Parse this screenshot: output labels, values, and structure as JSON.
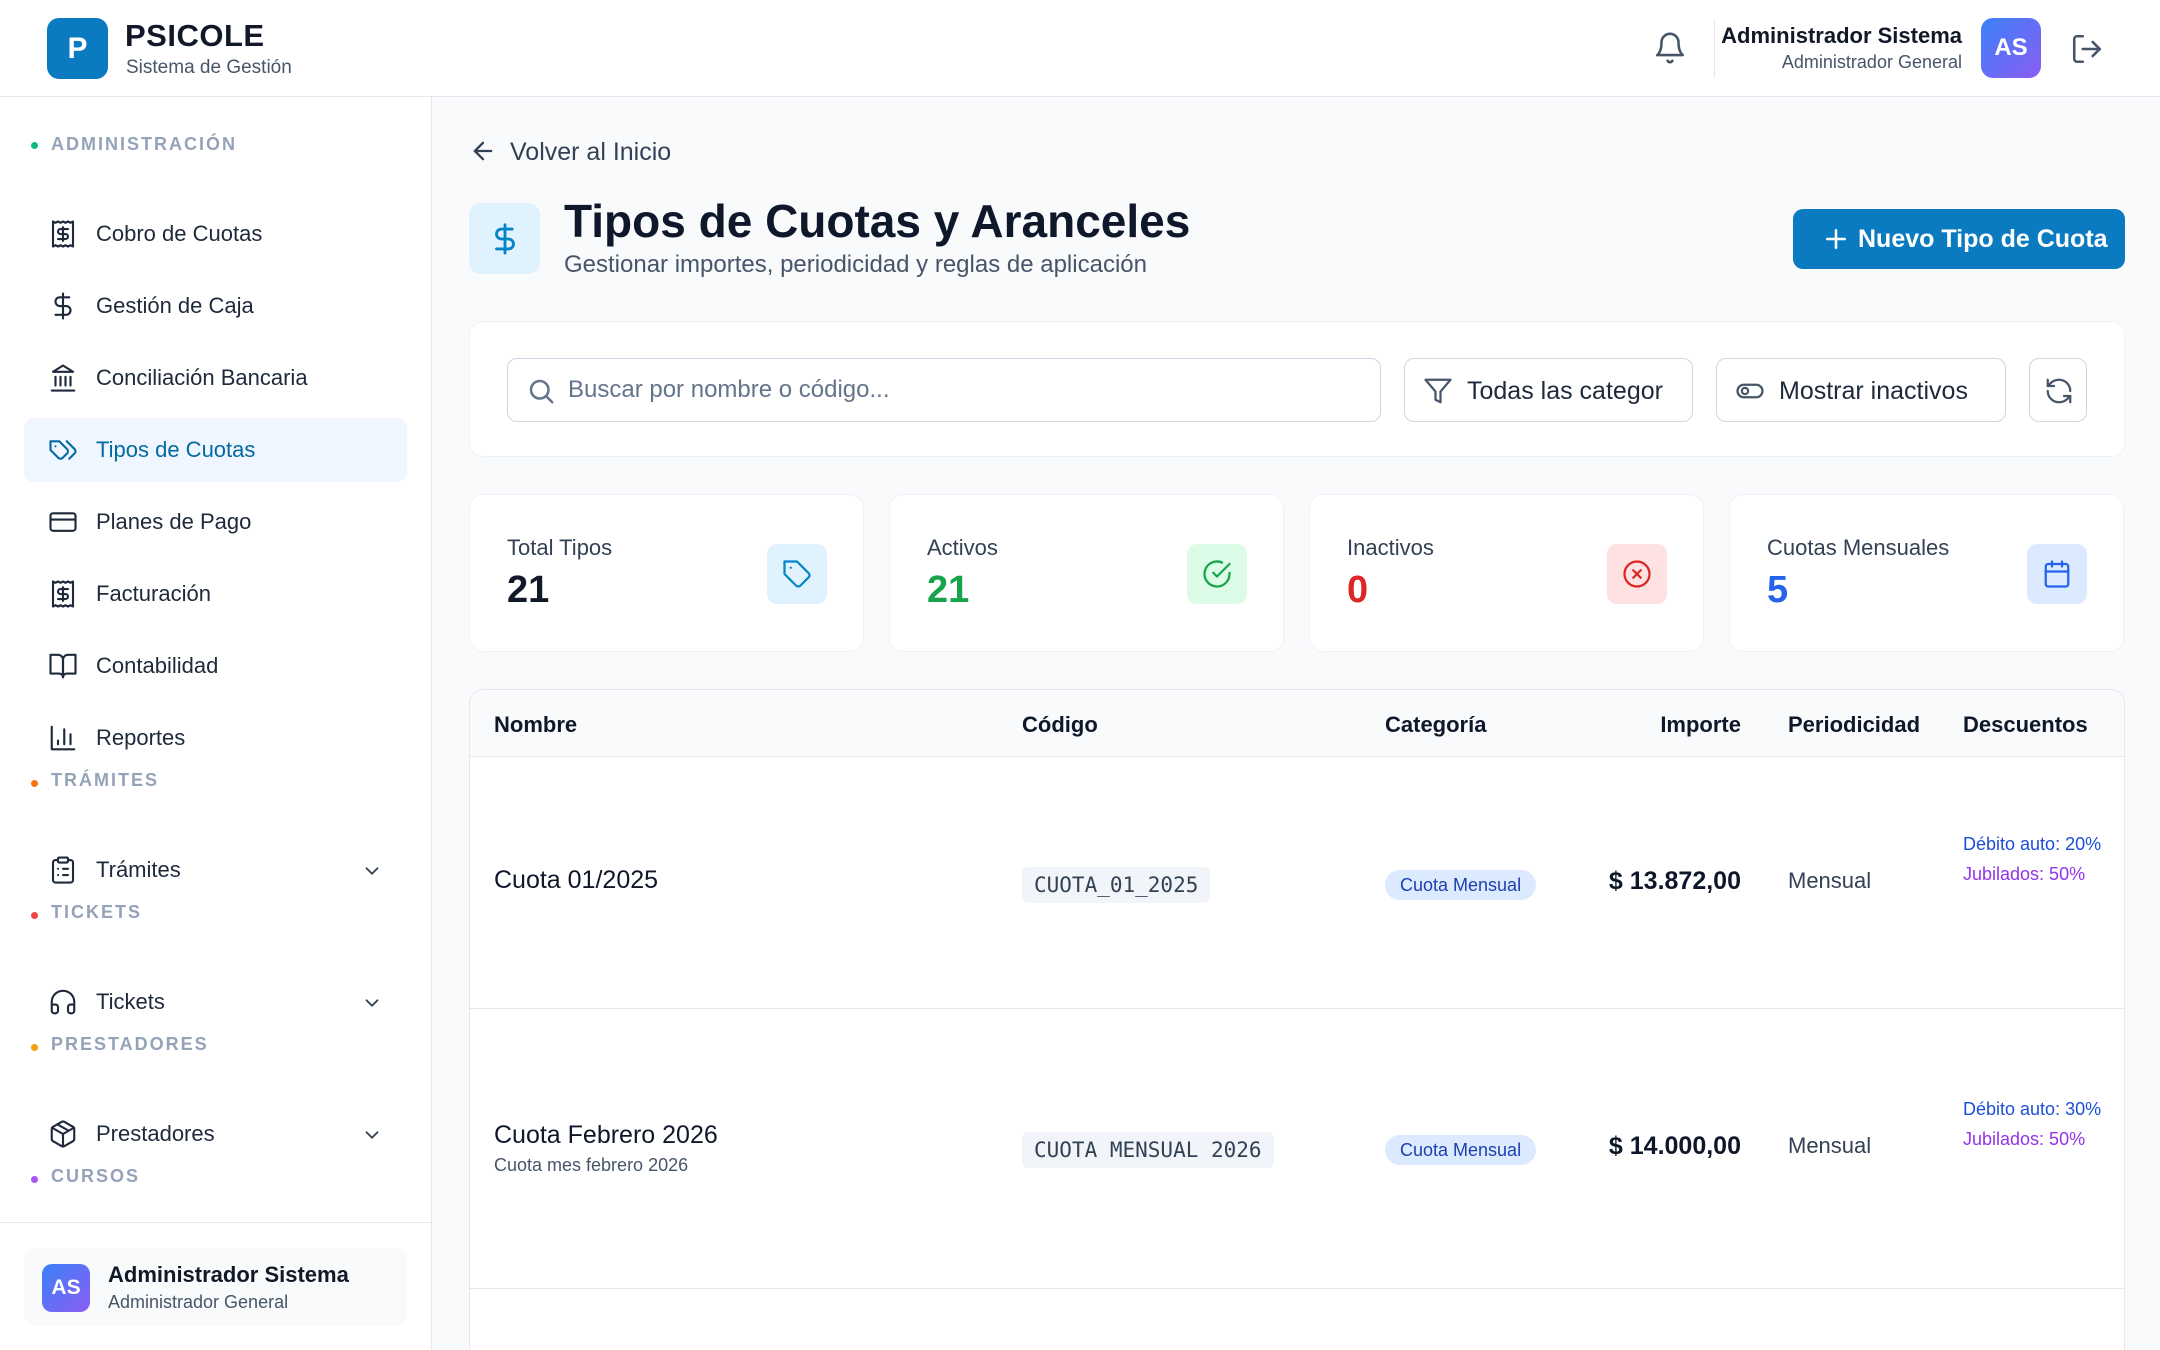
{
  "header": {
    "logo_letter": "P",
    "app_name": "PSICOLE",
    "app_subtitle": "Sistema de Gestión",
    "user_name": "Administrador Sistema",
    "user_role": "Administrador General",
    "user_initials": "AS"
  },
  "sidebar": {
    "sections": [
      {
        "title": "ADMINISTRACIÓN",
        "color": "#10b981"
      },
      {
        "title": "TRÁMITES",
        "color": "#f97316"
      },
      {
        "title": "TICKETS",
        "color": "#ef4444"
      },
      {
        "title": "PRESTADORES",
        "color": "#f59e0b"
      },
      {
        "title": "CURSOS",
        "color": "#a855f7"
      }
    ],
    "items": [
      {
        "label": "Cobro de Cuotas",
        "icon": "receipt-dollar-icon"
      },
      {
        "label": "Gestión de Caja",
        "icon": "dollar-icon"
      },
      {
        "label": "Conciliación Bancaria",
        "icon": "bank-icon"
      },
      {
        "label": "Tipos de Cuotas",
        "icon": "tags-icon",
        "active": true
      },
      {
        "label": "Planes de Pago",
        "icon": "credit-card-icon"
      },
      {
        "label": "Facturación",
        "icon": "receipt-dollar-icon"
      },
      {
        "label": "Contabilidad",
        "icon": "book-open-icon"
      },
      {
        "label": "Reportes",
        "icon": "bar-chart-icon"
      },
      {
        "label": "Trámites",
        "icon": "clipboard-icon"
      },
      {
        "label": "Tickets",
        "icon": "headphones-icon"
      },
      {
        "label": "Prestadores",
        "icon": "package-icon"
      }
    ],
    "footer": {
      "initials": "AS",
      "name": "Administrador Sistema",
      "role": "Administrador General"
    }
  },
  "main": {
    "back_label": "Volver al Inicio",
    "title": "Tipos de Cuotas y Aranceles",
    "subtitle": "Gestionar importes, periodicidad y reglas de aplicación",
    "new_button": "Nuevo Tipo de Cuota",
    "search_placeholder": "Buscar por nombre o código...",
    "category_filter": "Todas las categor",
    "inactive_toggle": "Mostrar inactivos",
    "stats": [
      {
        "label": "Total Tipos",
        "value": "21",
        "color": "#111827",
        "icon": "tag-icon",
        "bg": "#e0f2fe",
        "icon_color": "#0284c7"
      },
      {
        "label": "Activos",
        "value": "21",
        "color": "#16a34a",
        "icon": "check-circle-icon",
        "bg": "#dcfce7",
        "icon_color": "#16a34a"
      },
      {
        "label": "Inactivos",
        "value": "0",
        "color": "#dc2626",
        "icon": "x-circle-icon",
        "bg": "#fee2e2",
        "icon_color": "#dc2626"
      },
      {
        "label": "Cuotas Mensuales",
        "value": "5",
        "color": "#2563eb",
        "icon": "calendar-icon",
        "bg": "#dbeafe",
        "icon_color": "#2563eb"
      }
    ],
    "table": {
      "columns": [
        "Nombre",
        "Código",
        "Categoría",
        "Importe",
        "Periodicidad",
        "Descuentos"
      ],
      "rows": [
        {
          "name": "Cuota 01/2025",
          "description": "",
          "code": "CUOTA_01_2025",
          "category": "Cuota Mensual",
          "amount": "$ 13.872,00",
          "period": "Mensual",
          "discount_auto": "Débito auto: 20%",
          "discount_retired": "Jubilados: 50%"
        },
        {
          "name": "Cuota Febrero 2026",
          "description": "Cuota mes febrero 2026",
          "code": "CUOTA MENSUAL 2026",
          "category": "Cuota Mensual",
          "amount": "$ 14.000,00",
          "period": "Mensual",
          "discount_auto": "Débito auto: 30%",
          "discount_retired": "Jubilados: 50%"
        }
      ]
    }
  }
}
